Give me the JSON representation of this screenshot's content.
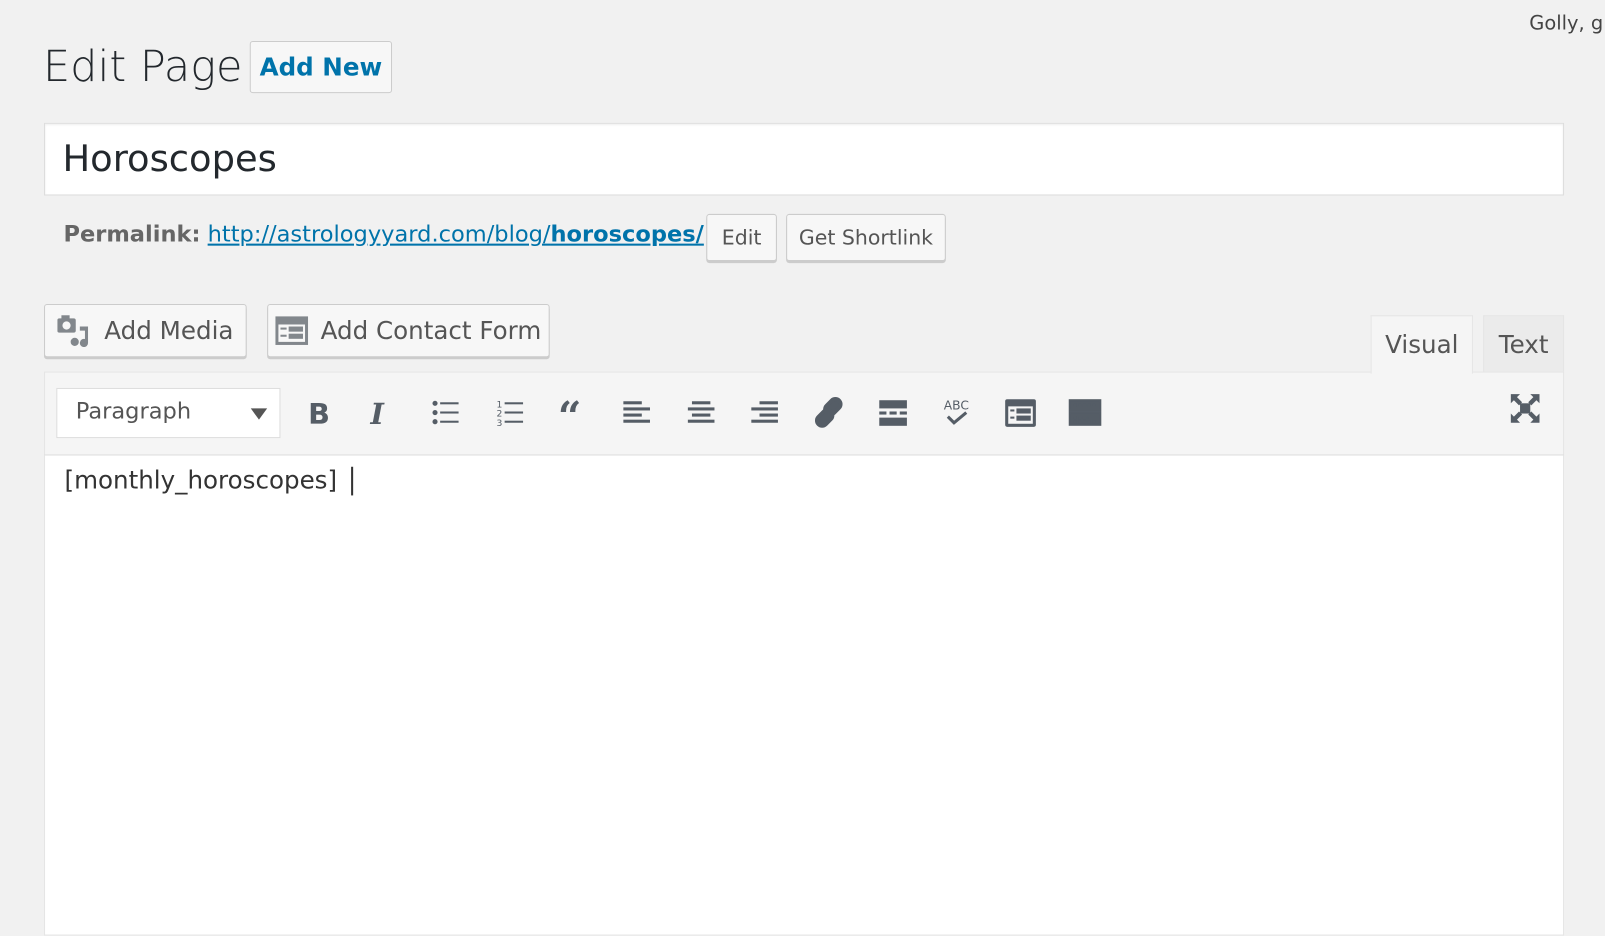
{
  "header": {
    "greeting": "Golly, g",
    "title": "Edit Page",
    "add_new": "Add New"
  },
  "post": {
    "title": "Horoscopes",
    "permalink_label": "Permalink:",
    "permalink_base": "http://astrologyyard.com/blog/",
    "permalink_slug": "horoscopes/",
    "edit_label": "Edit",
    "shortlink_label": "Get Shortlink"
  },
  "media": {
    "add_media": "Add Media",
    "add_contact_form": "Add Contact Form"
  },
  "editor": {
    "tabs": [
      {
        "label": "Visual",
        "active": true
      },
      {
        "label": "Text",
        "active": false
      }
    ],
    "format_select": "Paragraph",
    "toolbar_icons": [
      "bold-icon",
      "italic-icon",
      "bulleted-list-icon",
      "numbered-list-icon",
      "blockquote-icon",
      "align-left-icon",
      "align-center-icon",
      "align-right-icon",
      "link-icon",
      "read-more-icon",
      "spellcheck-icon",
      "contact-form-icon",
      "toolbar-toggle-icon",
      "fullscreen-icon"
    ],
    "content": "[monthly_horoscopes]"
  },
  "colors": {
    "link": "#0073aa",
    "background": "#f1f1f1",
    "icon": "#555d66"
  }
}
